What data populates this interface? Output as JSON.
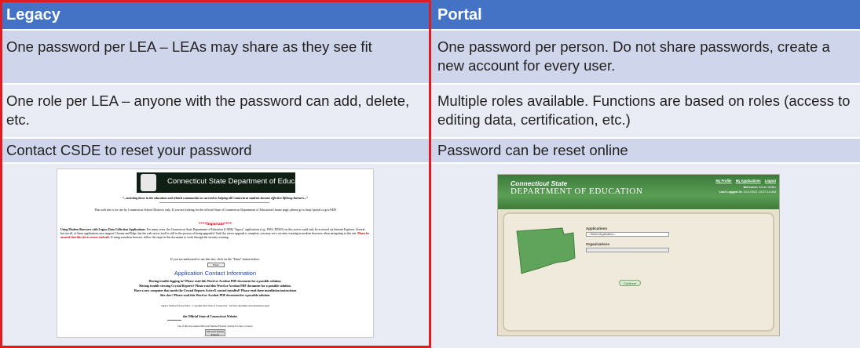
{
  "columns": {
    "legacy": {
      "header": "Legacy"
    },
    "portal": {
      "header": "Portal"
    }
  },
  "rows": [
    {
      "legacy": "One password per LEA – LEAs may share as they see fit",
      "portal": "One password per person. Do not share passwords, create a new account for every user."
    },
    {
      "legacy": "One role per LEA – anyone with the password can add, delete, etc.",
      "portal": "Multiple roles available. Functions are based on roles (access to editing data, certification, etc.)"
    },
    {
      "legacy": "Contact CSDE to reset your password",
      "portal": "Password can be reset online"
    }
  ],
  "legacy_screenshot": {
    "banner_title": "Connecticut State Department of Education",
    "tagline": "“...assisting those in the education and related communities to succeed in helping all Connecticut students become effective lifelong learners...”",
    "notice": "This web site is for use by Connecticut School Districts only. If you are looking for the official State of Connecticut Department of Education's home page, please go to http://portal.ct.gov/SDE",
    "important": "****Important****",
    "para_lead": "Using Modern Browsers with Legacy Data Collection Applications:",
    "para_body": "For many years, the Connecticut State Department of Education (CSDE) \"legacy\" applications (e.g., PSIS, ED165) on this server could only be accessed via Internet Explorer. Several, but not all, of these applications now support Chrome and Edge, but the web server itself is still in the process of being upgraded. Until the server upgrade is complete, you may see a security warning in modern browsers when navigating to this site.",
    "para_red": "Please be assured that this site is secure and safe.",
    "para_tail": "If using a modern browser, follow the steps in this document to work through the security warning.",
    "authorized": "If you are authorized to use this site, click on the \"Enter\" button below:",
    "enter_button": "Enter",
    "contact_heading": "Application Contact Information",
    "help_lines": [
      "Having trouble logging in? Please read this Word or Acrobat PDF document for a possible solution.",
      "Having trouble viewing Crystal Reports? Please read this Word or Acrobat PDF document for a possible solution.",
      "Have a new computer that needs the Crystal Reports ActiveX control installed? Please read these installation instructions",
      "Site slow? Please read this Word or Acrobat PDF document for a possible solution."
    ],
    "footer": "Agency Website Privacy Policy · Copyright 2023 State of Connecticut · All State disclaimer and permissions apply",
    "official": "the Official State of Connecticut Website",
    "compat": "Use of this site requires Microsoft Internet Explorer version 6 or later, or newer",
    "badge": "Microsoft Internet Explorer"
  },
  "portal_screenshot": {
    "title_line1": "Connecticut State",
    "title_line2": "DEPARTMENT OF EDUCATION",
    "links": [
      "My Profile",
      "My Applications",
      "Logout"
    ],
    "welcome_label": "Welcome:",
    "welcome_value": "Kevin Heller",
    "last_logged_label": "Last Logged In:",
    "last_logged_value": "01/1/2021 10:07:16 AM",
    "applications_label": "Applications",
    "applications_value": "--Select Application--",
    "organizations_label": "Organizations",
    "continue_button": "Continue"
  },
  "colors": {
    "header": "#4472c4",
    "row_dark": "#cfd5ea",
    "row_light": "#e9ebf5",
    "highlight": "#e11b22"
  }
}
